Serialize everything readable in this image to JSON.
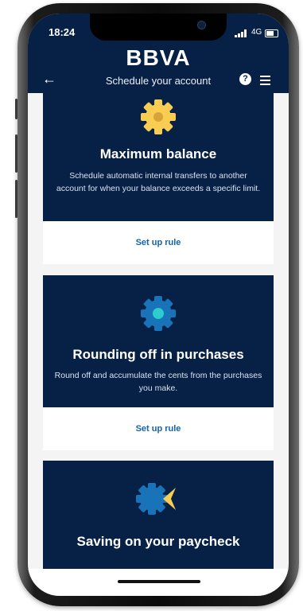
{
  "status": {
    "time": "18:24",
    "network": "4G"
  },
  "header": {
    "logo": "BBVA",
    "title": "Schedule your account"
  },
  "cards": [
    {
      "title": "Maximum balance",
      "description": "Schedule automatic internal transfers to another account for when your balance exceeds a specific limit.",
      "action": "Set up rule",
      "icon": "gold-gear-icon"
    },
    {
      "title": "Rounding off in purchases",
      "description": "Round off and accumulate the cents from the purchases you make.",
      "action": "Set up rule",
      "icon": "blue-gear-icon"
    },
    {
      "title": "Saving on your paycheck",
      "icon": "paycheck-gear-icon"
    }
  ],
  "colors": {
    "navy": "#072146",
    "link": "#1464a5",
    "gold": "#f8cd51",
    "cyan": "#2dcccd",
    "blue": "#1973b8"
  }
}
